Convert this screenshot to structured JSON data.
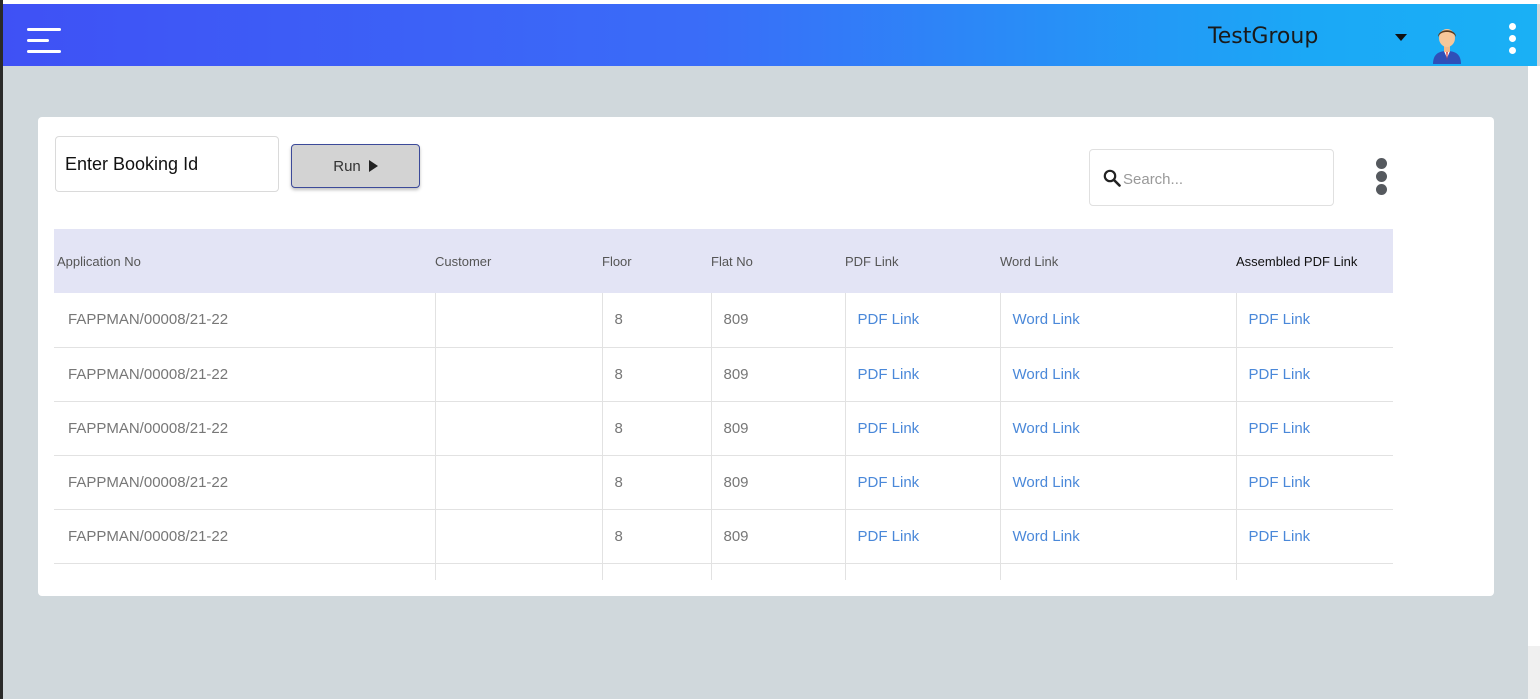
{
  "header": {
    "group_name": "TestGroup",
    "icons": [
      "menu-icon",
      "caret-down-icon",
      "avatar-icon",
      "more-vert-icon"
    ]
  },
  "toolbar": {
    "booking_placeholder": "Enter Booking Id",
    "run_label": "Run",
    "search_placeholder": "Search..."
  },
  "table": {
    "columns": [
      "Application No",
      "Customer",
      "Floor",
      "Flat No",
      "PDF Link",
      "Word Link",
      "Assembled PDF Link"
    ],
    "rows": [
      [
        "FAPPMAN/00008/21-22",
        "",
        "8",
        "809",
        "PDF Link",
        "Word Link",
        "PDF Link"
      ],
      [
        "FAPPMAN/00008/21-22",
        "",
        "8",
        "809",
        "PDF Link",
        "Word Link",
        "PDF Link"
      ],
      [
        "FAPPMAN/00008/21-22",
        "",
        "8",
        "809",
        "PDF Link",
        "Word Link",
        "PDF Link"
      ],
      [
        "FAPPMAN/00008/21-22",
        "",
        "8",
        "809",
        "PDF Link",
        "Word Link",
        "PDF Link"
      ],
      [
        "FAPPMAN/00008/21-22",
        "",
        "8",
        "809",
        "PDF Link",
        "Word Link",
        "PDF Link"
      ]
    ]
  },
  "colors": {
    "header_gradient_start": "#3f51f5",
    "header_gradient_end": "#1ab0f5",
    "link": "#4a88d9",
    "table_header_bg": "#e3e4f5",
    "page_bg": "#d0d8dc"
  }
}
